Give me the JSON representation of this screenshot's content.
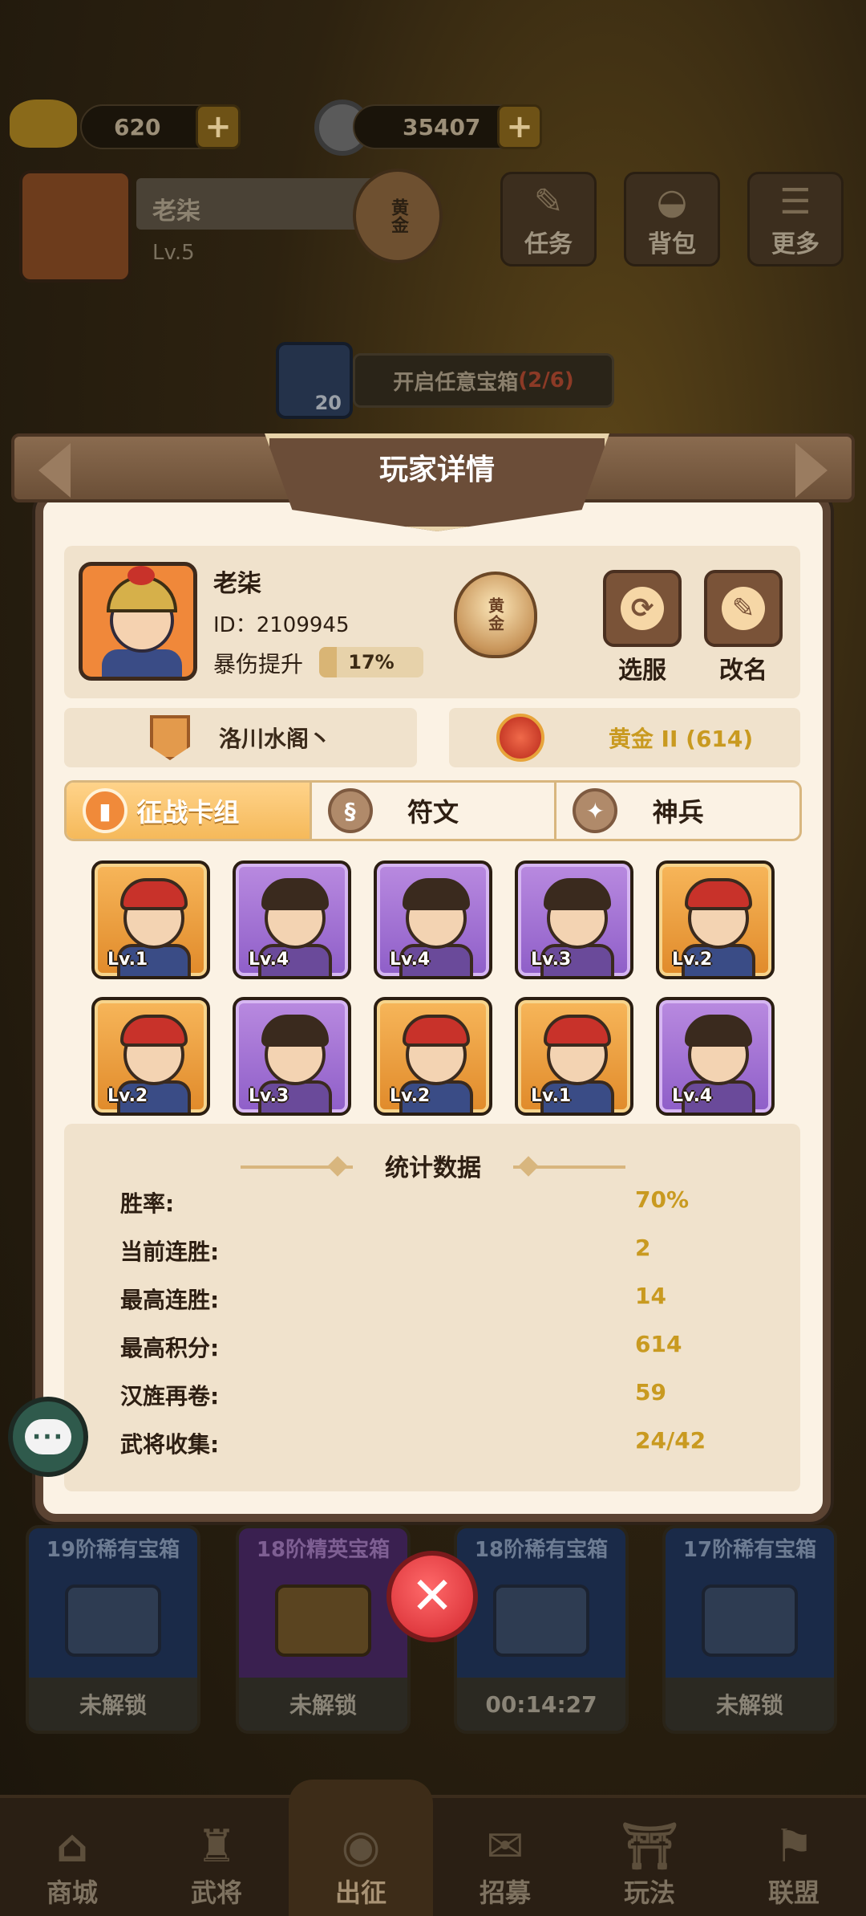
{
  "hud": {
    "gold_ingots": "620",
    "coins": "35407",
    "player_name": "老柒",
    "player_level": "Lv.5",
    "rank_badge": "黄金",
    "buttons": {
      "task": "任务",
      "bag": "背包",
      "more": "更多"
    },
    "chest_card_count": "20",
    "open_chest_task": "开启任意宝箱",
    "open_chest_progress": "(2/6)"
  },
  "chests": [
    {
      "title": "19阶稀有宝箱",
      "status": "未解锁"
    },
    {
      "title": "18阶精英宝箱",
      "status": "未解锁"
    },
    {
      "title": "18阶稀有宝箱",
      "status": "00:14:27"
    },
    {
      "title": "17阶稀有宝箱",
      "status": "未解锁"
    }
  ],
  "bottom_nav": [
    "商城",
    "武将",
    "出征",
    "招募",
    "玩法",
    "联盟"
  ],
  "modal": {
    "title": "玩家详情",
    "player": {
      "name": "老柒",
      "id": "ID：2109945",
      "crit_label": "暴伤提升",
      "crit_value": "17%",
      "crit_fraction": 0.17,
      "rank_badge": "黄金"
    },
    "actions": {
      "select_server": "选服",
      "rename": "改名"
    },
    "guild": "洛川水阁丶",
    "league": "黄金 II (614)",
    "tabs": [
      "征战卡组",
      "符文",
      "神兵"
    ],
    "cards": [
      {
        "level": "Lv.1",
        "rarity": "gold"
      },
      {
        "level": "Lv.4",
        "rarity": "purple"
      },
      {
        "level": "Lv.4",
        "rarity": "purple"
      },
      {
        "level": "Lv.3",
        "rarity": "purple"
      },
      {
        "level": "Lv.2",
        "rarity": "gold"
      },
      {
        "level": "Lv.2",
        "rarity": "gold"
      },
      {
        "level": "Lv.3",
        "rarity": "purple"
      },
      {
        "level": "Lv.2",
        "rarity": "gold"
      },
      {
        "level": "Lv.1",
        "rarity": "gold"
      },
      {
        "level": "Lv.4",
        "rarity": "purple"
      }
    ],
    "stats_title": "统计数据",
    "stats": [
      {
        "label": "胜率:",
        "value": "70%"
      },
      {
        "label": "当前连胜:",
        "value": "2"
      },
      {
        "label": "最高连胜:",
        "value": "14"
      },
      {
        "label": "最高积分:",
        "value": "614"
      },
      {
        "label": "汉旌再卷:",
        "value": "59"
      },
      {
        "label": "武将收集:",
        "value": "24/42"
      }
    ]
  },
  "colors": {
    "accent_gold": "#c99a20",
    "panel_bg": "#fbf2e4",
    "tab_active": "#f5b95a",
    "card_gold": "#e08a2a",
    "card_purple": "#8e5ec8",
    "close_red": "#d3262e"
  },
  "icons": {
    "chat": "chat-bubble-icon",
    "close": "close-x-icon",
    "select_server": "refresh-icon",
    "rename": "pencil-icon"
  }
}
